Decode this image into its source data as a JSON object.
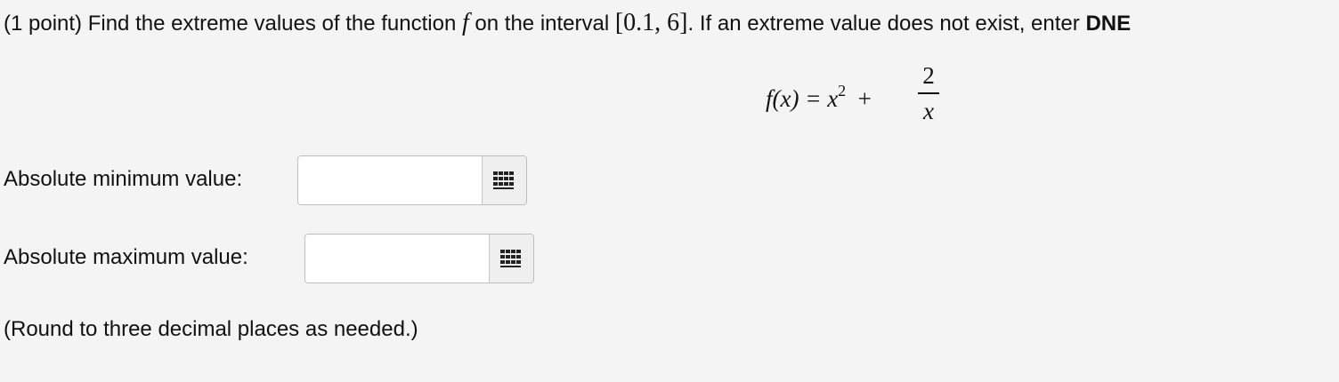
{
  "problem": {
    "point_label": "(1 point)",
    "text_before_f": "Find the extreme values of the function",
    "function_symbol": "f",
    "text_on_interval": "on the interval",
    "interval": "[0.1, 6]",
    "text_period_if": ". If an extreme value does not exist, enter",
    "dne": "DNE"
  },
  "formula": {
    "lhs": "f(x) = x",
    "exponent": "2",
    "plus": "+",
    "numerator": "2",
    "denominator": "x"
  },
  "fields": [
    {
      "label": "Absolute minimum value:",
      "value": "",
      "palette_icon": "grid-palette-icon"
    },
    {
      "label": "Absolute maximum value:",
      "value": "",
      "palette_icon": "grid-palette-icon"
    }
  ],
  "note": "(Round to three decimal places as needed.)"
}
